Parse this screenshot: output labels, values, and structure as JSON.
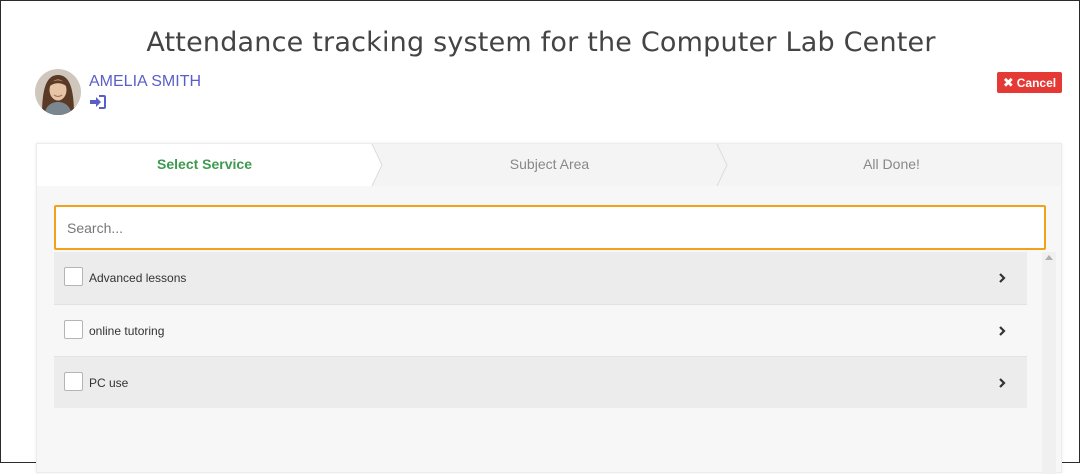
{
  "header": {
    "title": "Attendance tracking system for the Computer Lab Center"
  },
  "user": {
    "name": "AMELIA SMITH",
    "avatar_icon": "user-avatar",
    "signin_icon": "sign-in-icon"
  },
  "cancel": {
    "label": "Cancel",
    "icon": "close-icon",
    "color": "#e53935"
  },
  "wizard": {
    "steps": [
      {
        "label": "Select Service",
        "active": true
      },
      {
        "label": "Subject Area",
        "active": false
      },
      {
        "label": "All Done!",
        "active": false
      }
    ],
    "active_color": "#3d9a4e"
  },
  "search": {
    "placeholder": "Search...",
    "value": "",
    "focus_color": "#f2a11a"
  },
  "services": [
    {
      "label": "Advanced lessons",
      "checked": false
    },
    {
      "label": "online tutoring",
      "checked": false
    },
    {
      "label": "PC use",
      "checked": false
    }
  ],
  "accent_color": "#5a5fc8"
}
